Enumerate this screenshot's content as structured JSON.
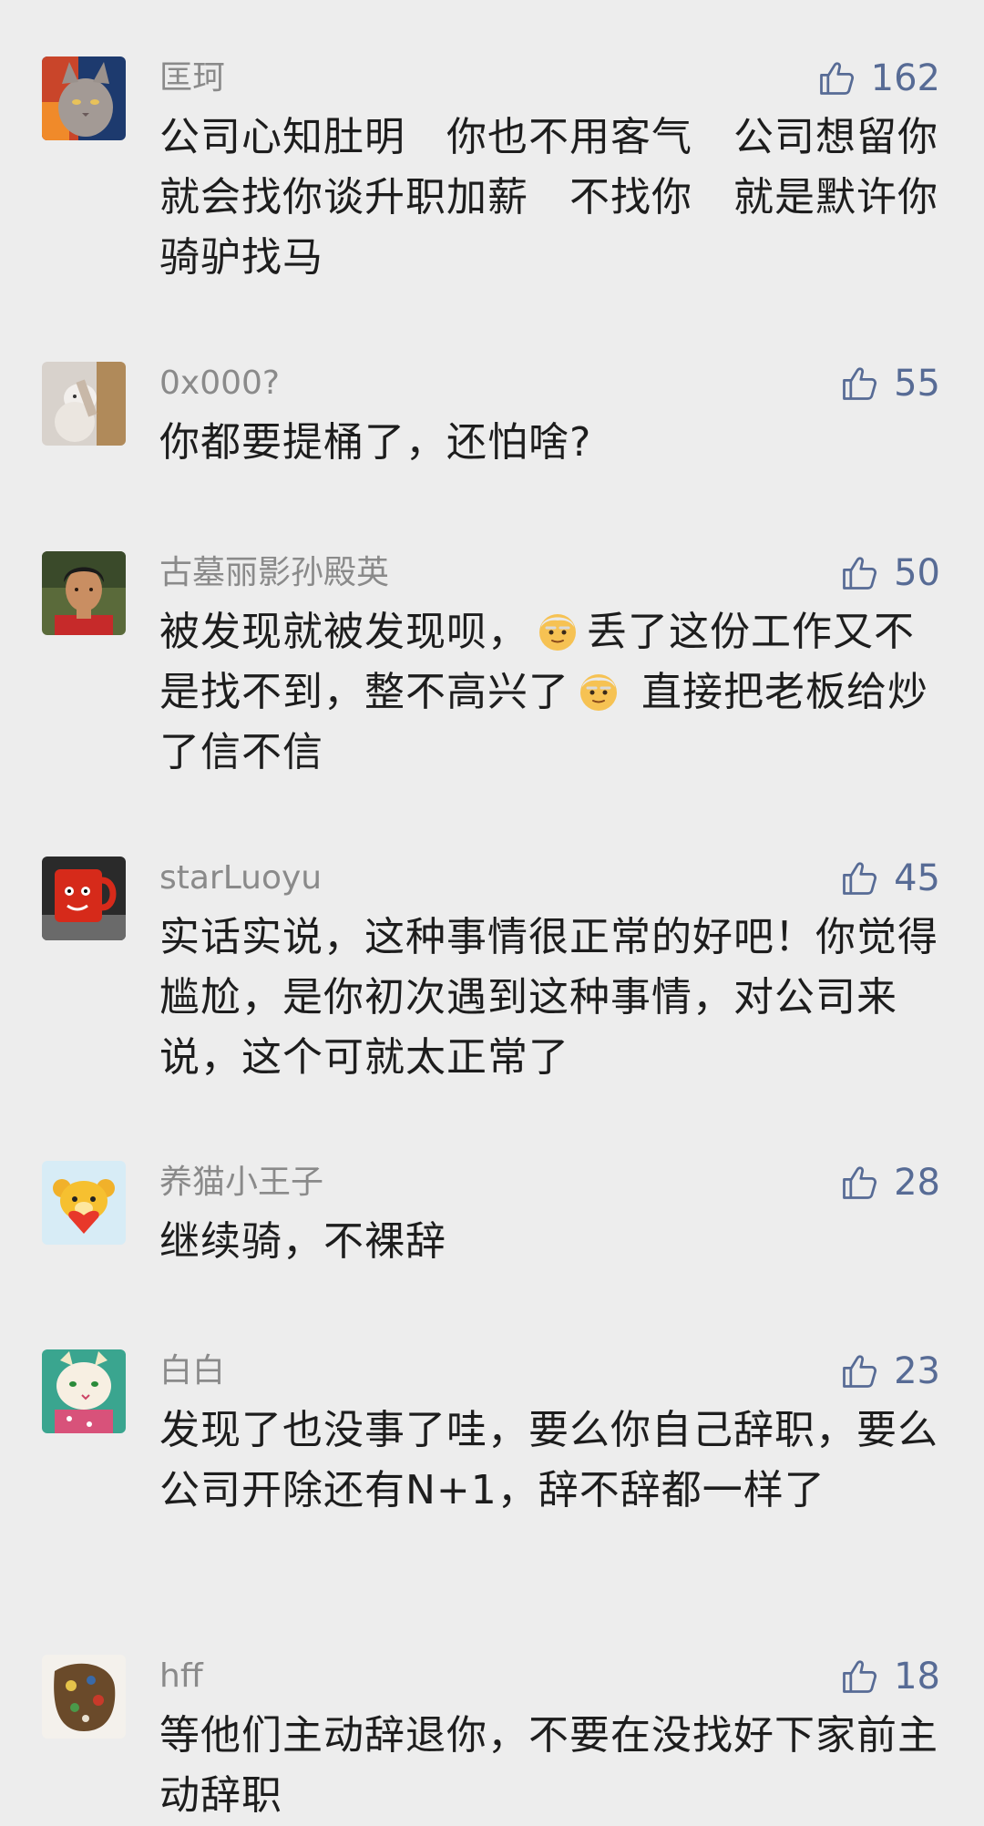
{
  "comments": [
    {
      "username": "匡珂",
      "likes": "162",
      "text": "公司心知肚明　你也不用客气　公司想留你　就会找你谈升职加薪　不找你　就是默许你骑驴找马",
      "avatar_icon": "cat-avatar"
    },
    {
      "username": "0x000?",
      "likes": "55",
      "text": "你都要提桶了，还怕啥?",
      "avatar_icon": "cat-photo-avatar"
    },
    {
      "username": "古墓丽影孙殿英",
      "likes": "50",
      "text_a": "被发现就被发现呗，",
      "text_b": "丢了这份工作又不是找不到，整不高兴了",
      "text_c": " 直接把老板给炒了信不信",
      "emoji_icon": "old-man-emoji",
      "avatar_icon": "man-portrait-avatar"
    },
    {
      "username": "starLuoyu",
      "likes": "45",
      "text": "实话实说，这种事情很正常的好吧！你觉得尴尬，是你初次遇到这种事情，对公司来说，这个可就太正常了",
      "avatar_icon": "red-mug-avatar"
    },
    {
      "username": "养猫小王子",
      "likes": "28",
      "text": "继续骑，不裸辞",
      "avatar_icon": "bear-avatar"
    },
    {
      "username": "白白",
      "likes": "23",
      "text": "发现了也没事了哇，要么你自己辞职，要么公司开除还有N+1，辞不辞都一样了",
      "avatar_icon": "cartoon-cat-avatar"
    },
    {
      "username": "hff",
      "likes": "18",
      "text": "等他们主动辞退你，不要在没找好下家前主动辞职",
      "avatar_icon": "painting-avatar"
    }
  ],
  "colors": {
    "background": "#ededed",
    "username": "#8a8a8a",
    "like": "#576b95",
    "text": "#1d1d1d"
  }
}
